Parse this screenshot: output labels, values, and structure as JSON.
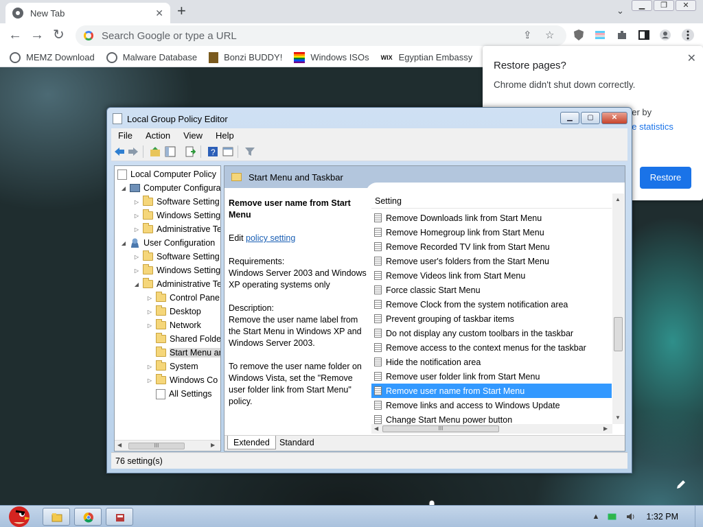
{
  "browser": {
    "tab_title": "New Tab",
    "tab_close": "✕",
    "new_tab": "+",
    "tab_search": "⌄",
    "omnibox_placeholder": "Search Google or type a URL",
    "bookmarks": [
      {
        "label": "MEMZ Download"
      },
      {
        "label": "Malware Database"
      },
      {
        "label": "Bonzi BUDDY!"
      },
      {
        "label": "Windows ISOs"
      },
      {
        "label": "Egyptian Embassy",
        "icon_text": "WIX"
      }
    ],
    "restore_popup": {
      "title": "Restore pages?",
      "message": "Chrome didn't shut down correctly.",
      "fragment_1": "tter by",
      "fragment_2": "ge statistics",
      "button": "Restore"
    }
  },
  "gpedit": {
    "title": "Local Group Policy Editor",
    "menu": [
      "File",
      "Action",
      "View",
      "Help"
    ],
    "tree": [
      {
        "label": "Local Computer Policy",
        "icon": "policy",
        "arrow": ""
      },
      {
        "label": "Computer Configura",
        "icon": "comp",
        "arrow": "◢"
      },
      {
        "label": "Software Setting",
        "icon": "folder",
        "arrow": "▷"
      },
      {
        "label": "Windows Setting",
        "icon": "folder",
        "arrow": "▷"
      },
      {
        "label": "Administrative Te",
        "icon": "folder",
        "arrow": "▷"
      },
      {
        "label": "User Configuration",
        "icon": "user",
        "arrow": "◢"
      },
      {
        "label": "Software Setting",
        "icon": "folder",
        "arrow": "▷"
      },
      {
        "label": "Windows Setting",
        "icon": "folder",
        "arrow": "▷"
      },
      {
        "label": "Administrative Te",
        "icon": "folder",
        "arrow": "◢"
      },
      {
        "label": "Control Pane",
        "icon": "folder",
        "arrow": "▷"
      },
      {
        "label": "Desktop",
        "icon": "folder",
        "arrow": "▷"
      },
      {
        "label": "Network",
        "icon": "folder",
        "arrow": "▷"
      },
      {
        "label": "Shared Folde",
        "icon": "folder",
        "arrow": ""
      },
      {
        "label": "Start Menu ar",
        "icon": "folder",
        "arrow": "",
        "selected": true
      },
      {
        "label": "System",
        "icon": "folder",
        "arrow": "▷"
      },
      {
        "label": "Windows Co",
        "icon": "folder",
        "arrow": "▷"
      },
      {
        "label": "All Settings",
        "icon": "policy",
        "arrow": ""
      }
    ],
    "header_title": "Start Menu and Taskbar",
    "description": {
      "title": "Remove user name from Start Menu",
      "edit_prefix": "Edit ",
      "edit_link": "policy setting",
      "requirements": "Requirements:",
      "requirements_text": "Windows Server 2003 and Windows XP operating systems only",
      "description_label": "Description:",
      "description_text": "Remove the user name label from the Start Menu in Windows XP and Windows Server 2003.",
      "extra_text": "To remove the user name folder on Windows Vista, set the \"Remove user folder link from Start Menu\" policy."
    },
    "list_header": "Setting",
    "settings": [
      "Remove Downloads link from Start Menu",
      "Remove Homegroup link from Start Menu",
      "Remove Recorded TV link from Start Menu",
      "Remove user's folders from the Start Menu",
      "Remove Videos link from Start Menu",
      "Force classic Start Menu",
      "Remove Clock from the system notification area",
      "Prevent grouping of taskbar items",
      "Do not display any custom toolbars in the taskbar",
      "Remove access to the context menus for the taskbar",
      "Hide the notification area",
      "Remove user folder link from Start Menu",
      "Remove user name from Start Menu",
      "Remove links and access to Windows Update",
      "Change Start Menu power button"
    ],
    "selected_setting": "Remove user name from Start Menu",
    "tabs": [
      "Extended",
      "Standard"
    ],
    "active_tab": "Extended",
    "status": "76 setting(s)",
    "scroll_grip": "III"
  },
  "taskbar": {
    "clock": "1:32 PM"
  },
  "colors": {
    "selection": "#3399ff",
    "restore_button": "#1a73e8",
    "header_band": "#b3c6dd"
  }
}
